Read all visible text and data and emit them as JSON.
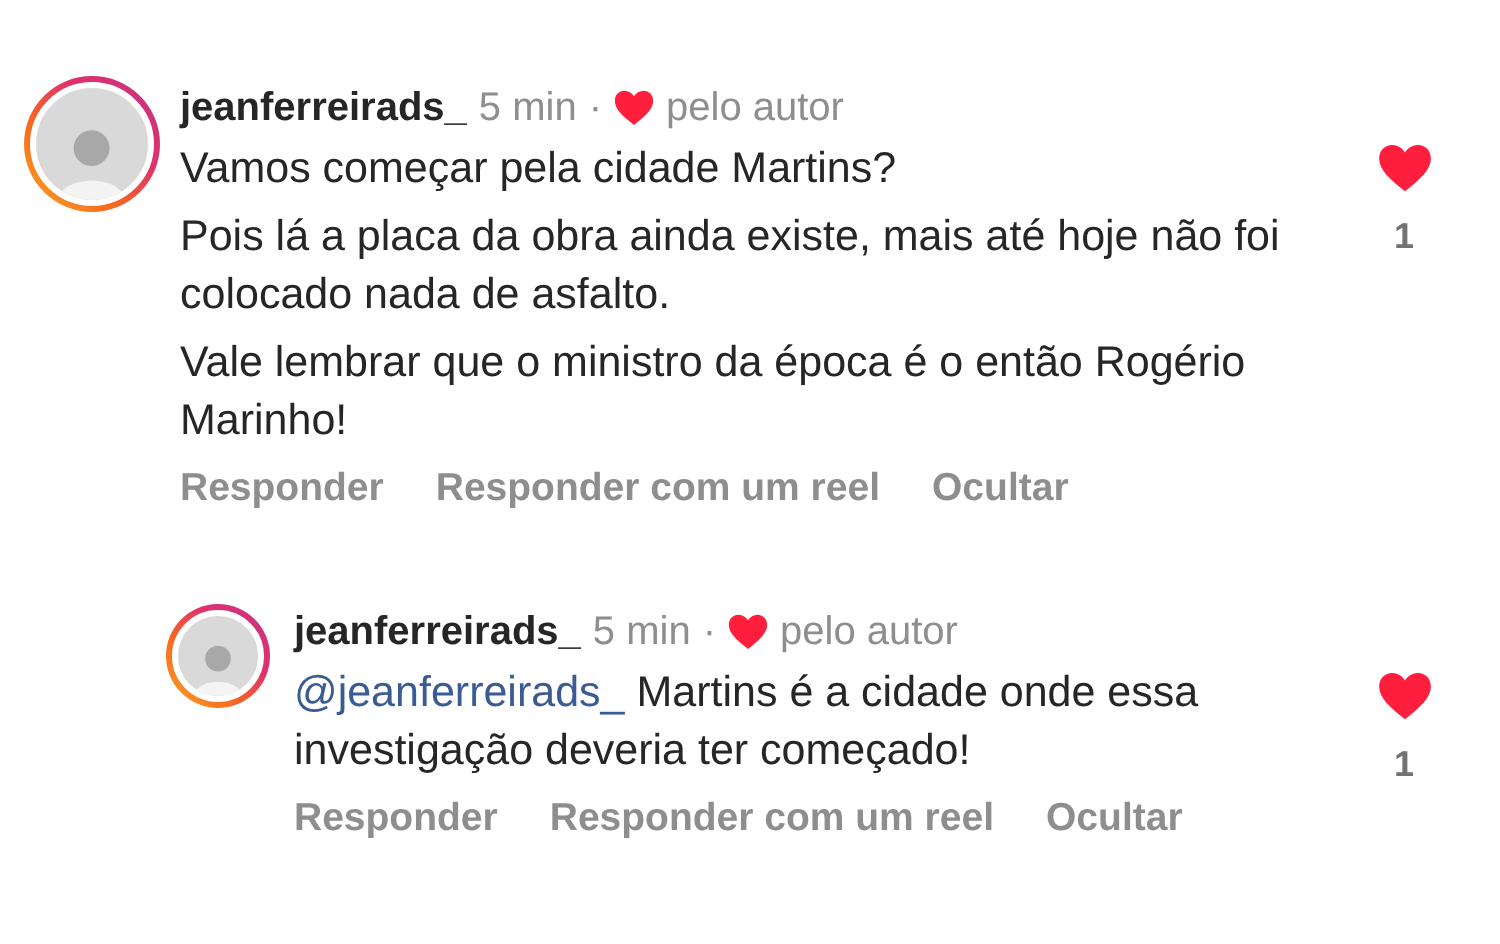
{
  "comments": [
    {
      "username": "jeanferreirads_",
      "time": "5 min",
      "separator": "·",
      "liked_by_author": true,
      "author_label": "pelo autor",
      "paragraphs": [
        {
          "text": "Vamos começar pela cidade Martins?"
        },
        {
          "text": "Pois lá a placa da obra ainda existe, mais até hoje não foi colocado nada de asfalto."
        },
        {
          "text": "Vale lembrar que o ministro da época é o então Rogério Marinho!"
        }
      ],
      "liked": true,
      "like_count": "1",
      "actions": [
        "Responder",
        "Responder com um reel",
        "Ocultar"
      ],
      "children": [
        {
          "username": "jeanferreirads_",
          "time": "5 min",
          "separator": "·",
          "liked_by_author": true,
          "author_label": "pelo autor",
          "mention": "@jeanferreirads_",
          "paragraphs": [
            {
              "text": "Martins é a cidade onde essa investigação deveria ter começado!"
            }
          ],
          "liked": true,
          "like_count": "1",
          "actions": [
            "Responder",
            "Responder com um reel",
            "Ocultar"
          ]
        }
      ]
    }
  ]
}
